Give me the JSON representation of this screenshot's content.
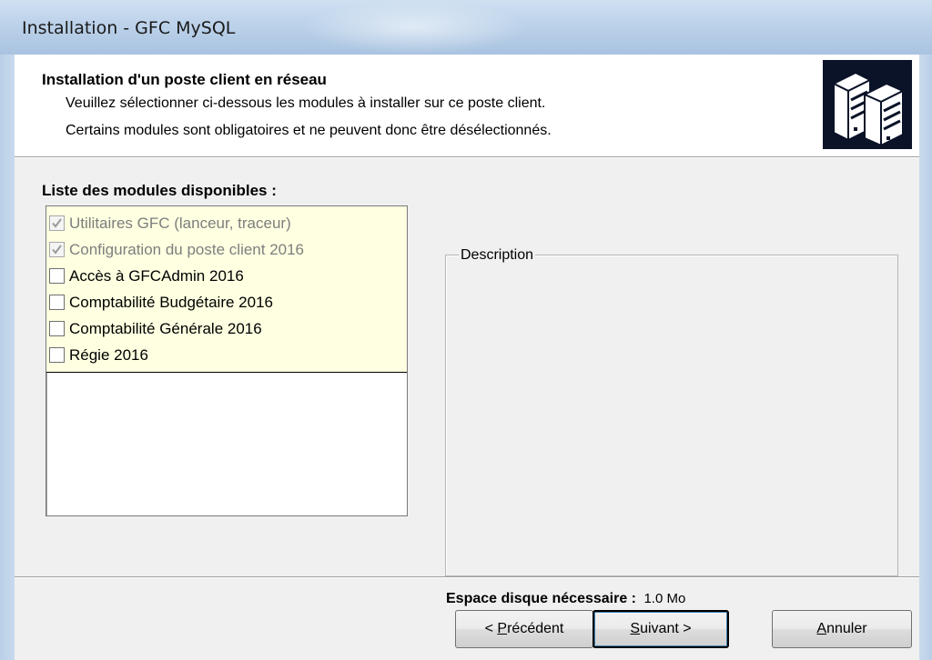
{
  "window": {
    "title": "Installation - GFC MySQL"
  },
  "header": {
    "title": "Installation d'un poste client en réseau",
    "line1": "Veuillez sélectionner ci-dessous les modules à installer sur ce poste client.",
    "line2": "Certains modules sont obligatoires et ne peuvent donc être désélectionnés.",
    "icon": "server-icon"
  },
  "modules": {
    "title": "Liste des modules disponibles :",
    "items": [
      {
        "label": "Utilitaires GFC (lanceur, traceur)",
        "checked": true,
        "disabled": true
      },
      {
        "label": "Configuration du poste client 2016",
        "checked": true,
        "disabled": true
      },
      {
        "label": "Accès à GFCAdmin 2016",
        "checked": false,
        "disabled": false
      },
      {
        "label": "Comptabilité Budgétaire 2016",
        "checked": false,
        "disabled": false
      },
      {
        "label": "Comptabilité Générale 2016",
        "checked": false,
        "disabled": false
      },
      {
        "label": "Régie 2016",
        "checked": false,
        "disabled": false
      }
    ]
  },
  "description": {
    "legend": "Description",
    "text": ""
  },
  "disk": {
    "label": "Espace disque nécessaire :",
    "value": "1.0 Mo"
  },
  "buttons": {
    "prev_prefix": "< ",
    "prev_accel": "P",
    "prev_rest": "récédent",
    "next_accel": "S",
    "next_rest": "uivant >",
    "cancel_accel": "A",
    "cancel_rest": "nnuler"
  },
  "colors": {
    "title_bar": "#bcd2ea",
    "list_highlight": "#ffffe1",
    "dialog_bg": "#f0f0f0",
    "icon_bg": "#0b1328"
  }
}
